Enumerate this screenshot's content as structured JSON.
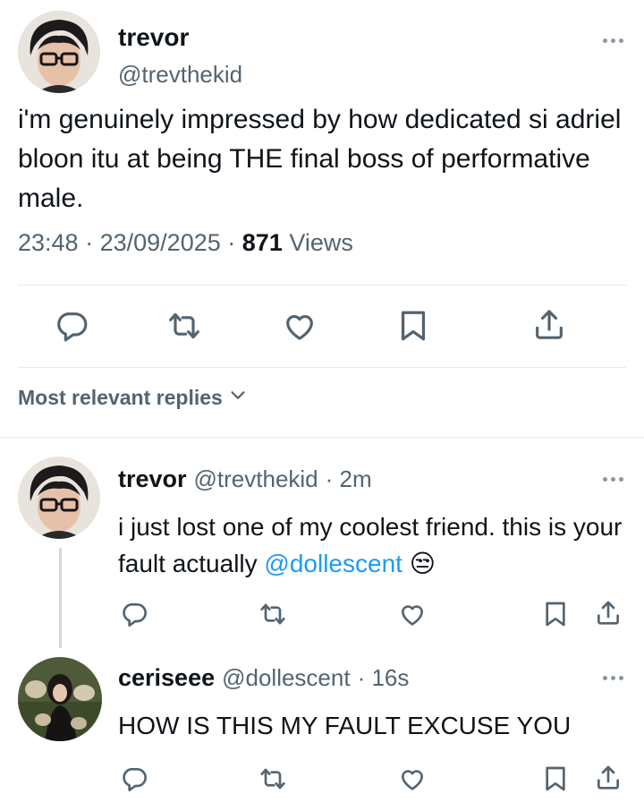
{
  "main_tweet": {
    "author_name": "trevor",
    "author_handle": "@trevthekid",
    "text": "i'm genuinely impressed by how dedicated si adriel bloon itu at being THE final boss of performative male.",
    "time": "23:48",
    "date": "23/09/2025",
    "separator": "·",
    "views_count": "871",
    "views_label": "Views"
  },
  "actions": {
    "icons": [
      "reply-icon",
      "retweet-icon",
      "like-icon",
      "bookmark-icon",
      "share-icon"
    ]
  },
  "sort": {
    "label": "Most relevant replies",
    "icon": "chevron-down-icon"
  },
  "replies": [
    {
      "name": "trevor",
      "handle": "@trevthekid",
      "time": "· 2m",
      "text_before": "i just lost one of my coolest friend. this is your fault actually ",
      "mention": "@dollescent",
      "emoji": "😒"
    },
    {
      "name": "ceriseee",
      "handle": "@dollescent",
      "time": "· 16s",
      "text": "HOW IS THIS MY FAULT EXCUSE YOU"
    }
  ],
  "colors": {
    "text": "#0f1419",
    "secondary": "#536471",
    "link": "#1d9bf0",
    "divider": "#e7e9ea",
    "icon": "#536471"
  }
}
